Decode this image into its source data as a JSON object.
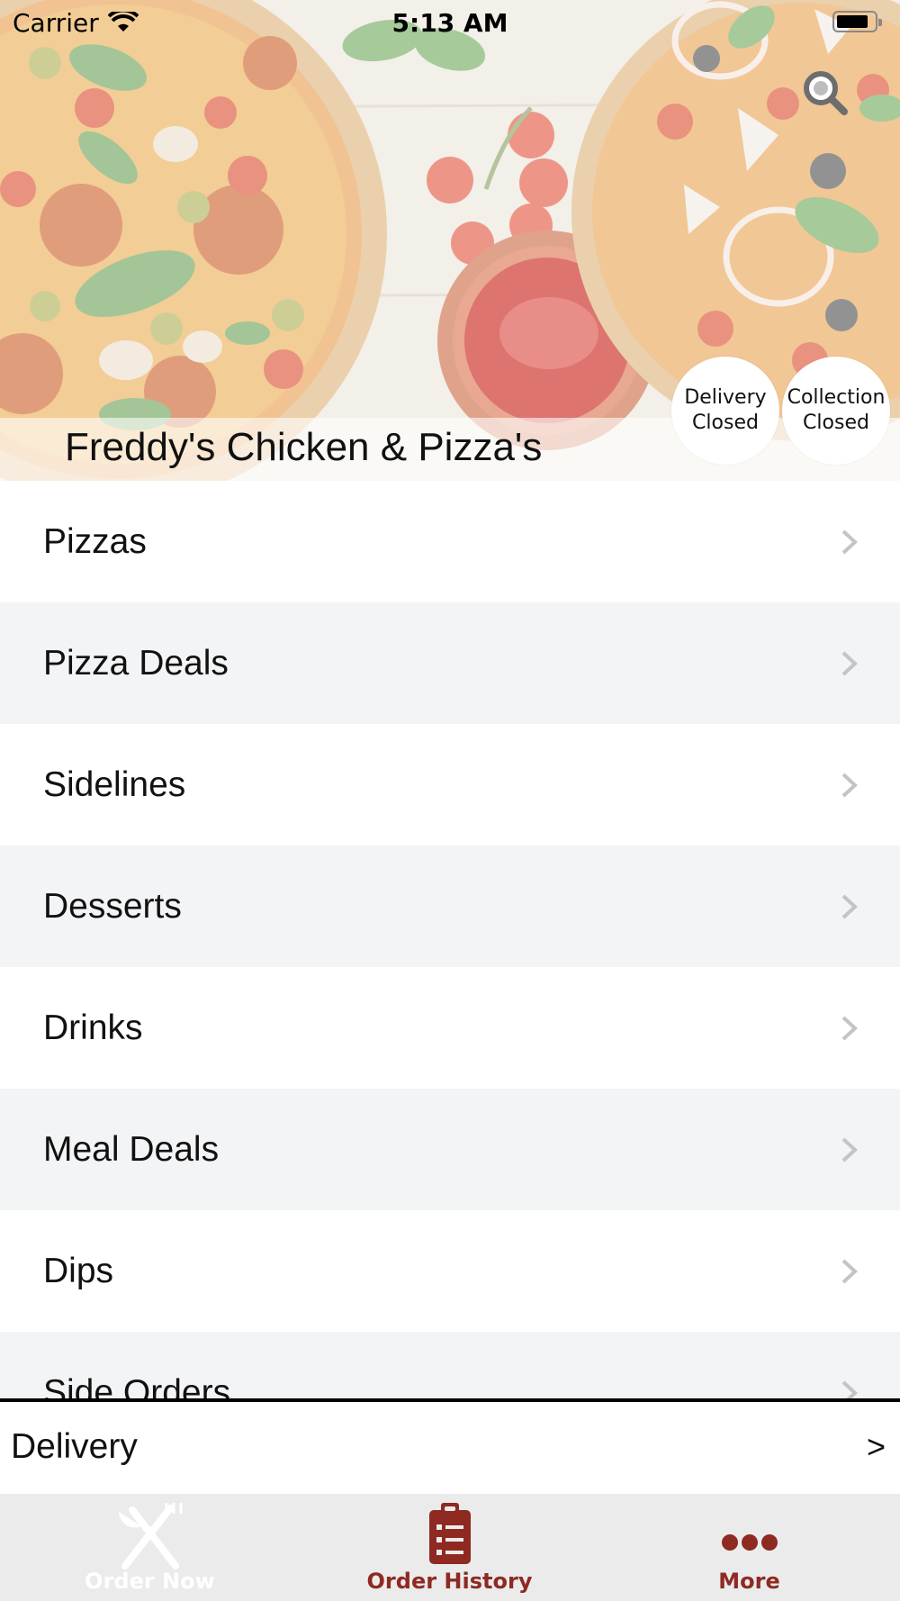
{
  "status_bar": {
    "carrier": "Carrier",
    "time": "5:13 AM"
  },
  "header": {
    "restaurant_name": "Freddy's Chicken & Pizza's",
    "delivery_badge": {
      "line1": "Delivery",
      "line2": "Closed"
    },
    "collection_badge": {
      "line1": "Collection",
      "line2": "Closed"
    }
  },
  "menu": {
    "items": [
      {
        "label": "Pizzas"
      },
      {
        "label": "Pizza Deals"
      },
      {
        "label": "Sidelines"
      },
      {
        "label": "Desserts"
      },
      {
        "label": "Drinks"
      },
      {
        "label": "Meal Deals"
      },
      {
        "label": "Dips"
      },
      {
        "label": "Side Orders"
      }
    ]
  },
  "order_type": {
    "label": "Delivery",
    "arrow": ">"
  },
  "tabbar": {
    "order_now": "Order Now",
    "order_history": "Order History",
    "more": "More"
  },
  "colors": {
    "accent": "#8e2a22",
    "tabbar_bg": "#ebebeb",
    "row_alt": "#f3f4f6"
  }
}
